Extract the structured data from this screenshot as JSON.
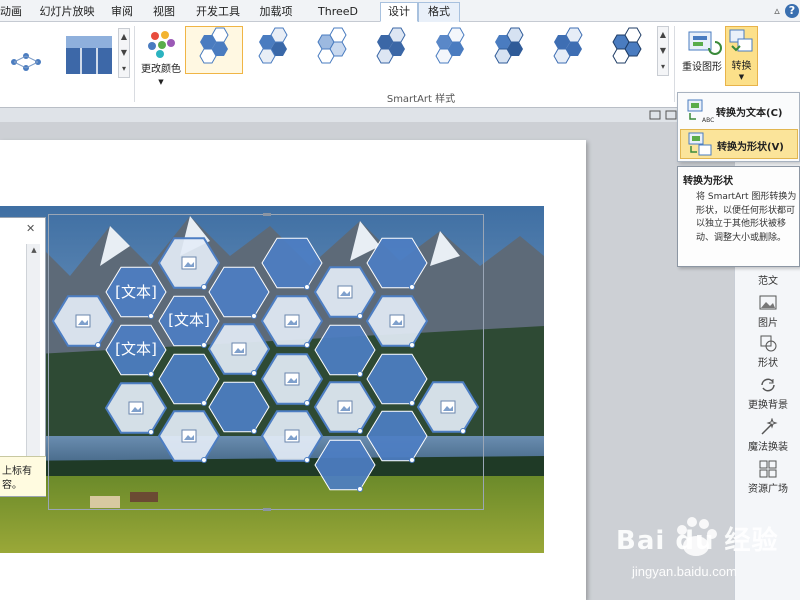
{
  "tabs": [
    "动画",
    "幻灯片放映",
    "审阅",
    "视图",
    "开发工具",
    "加载项",
    "ThreeD 2.1",
    "设计",
    "格式"
  ],
  "active_tab": "设计",
  "ribbon": {
    "change_colors_label": "更改颜色",
    "group_label": "SmartArt 样式",
    "reset_label": "重设图形",
    "convert_label": "转换"
  },
  "dropdown": {
    "to_text": "转换为文本(C)",
    "to_shapes": "转换为形状(V)"
  },
  "tooltip": {
    "title": "转换为形状",
    "body": "将 SmartArt 图形转换为形状，以便任何形状都可以独立于其他形状被移动、调整大小或删除。"
  },
  "canvas": {
    "text_placeholder": "[文本]",
    "text_pane_note_1": "上标有",
    "text_pane_note_2": "容。"
  },
  "side_panel": {
    "items": [
      "范文",
      "图片",
      "形状",
      "更换背景",
      "魔法换装",
      "资源广场"
    ]
  },
  "watermark": {
    "brand": "Bai du 经验",
    "site": "jingyan.baidu.com"
  },
  "colors": {
    "accent": "#4a7cc0",
    "highlight": "#fce08a",
    "hex_fill": "#4d7ec3",
    "hex_light": "#e3ecf6"
  }
}
